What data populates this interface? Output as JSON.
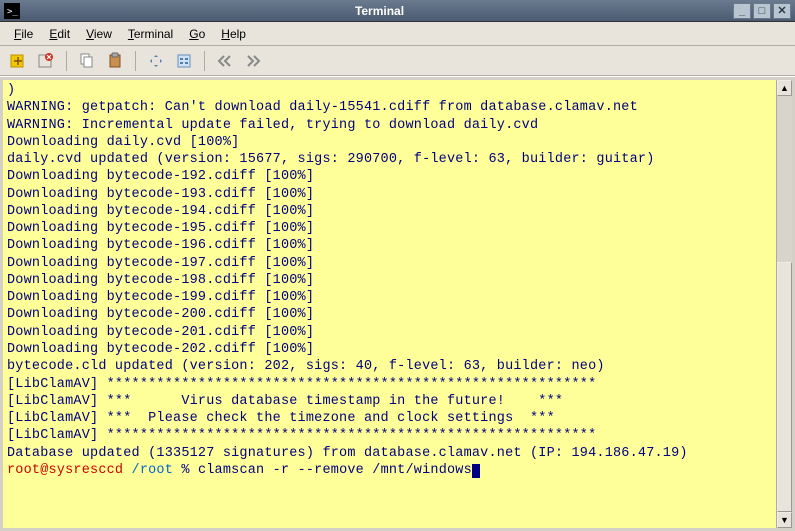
{
  "window": {
    "title": "Terminal"
  },
  "menu": {
    "file": "File",
    "edit": "Edit",
    "view": "View",
    "terminal": "Terminal",
    "go": "Go",
    "help": "Help"
  },
  "terminal_lines": [
    ")",
    "WARNING: getpatch: Can't download daily-15541.cdiff from database.clamav.net",
    "WARNING: Incremental update failed, trying to download daily.cvd",
    "Downloading daily.cvd [100%]",
    "daily.cvd updated (version: 15677, sigs: 290700, f-level: 63, builder: guitar)",
    "Downloading bytecode-192.cdiff [100%]",
    "Downloading bytecode-193.cdiff [100%]",
    "Downloading bytecode-194.cdiff [100%]",
    "Downloading bytecode-195.cdiff [100%]",
    "Downloading bytecode-196.cdiff [100%]",
    "Downloading bytecode-197.cdiff [100%]",
    "Downloading bytecode-198.cdiff [100%]",
    "Downloading bytecode-199.cdiff [100%]",
    "Downloading bytecode-200.cdiff [100%]",
    "Downloading bytecode-201.cdiff [100%]",
    "Downloading bytecode-202.cdiff [100%]",
    "bytecode.cld updated (version: 202, sigs: 40, f-level: 63, builder: neo)",
    "[LibClamAV] ***********************************************************",
    "[LibClamAV] ***      Virus database timestamp in the future!    ***",
    "[LibClamAV] ***  Please check the timezone and clock settings  ***",
    "[LibClamAV] ***********************************************************",
    "Database updated (1335127 signatures) from database.clamav.net (IP: 194.186.47.19)"
  ],
  "prompt": {
    "user": "root@sysresccd",
    "path": "/root",
    "symbol": "%",
    "command": "clamscan -r --remove /mnt/windows"
  }
}
